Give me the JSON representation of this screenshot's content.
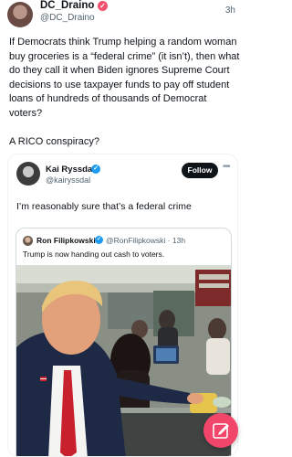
{
  "post": {
    "display_name": "DC_Draino",
    "handle": "@DC_Draino",
    "time": "3h",
    "text": "If Democrats think Trump helping a random woman buy groceries is a “federal crime” (it isn’t), then what do they call it when Biden ignores Supreme Court decisions to use taxpayer funds to pay off student loans of hundreds of thousands of Democrat voters?\n\nA RICO conspiracy?"
  },
  "quoted": {
    "display_name": "Kai Ryssdal",
    "handle": "@kairyssdal",
    "follow_label": "Follow",
    "text": "I’m reasonably sure that’s a federal crime"
  },
  "inner_quote": {
    "display_name": "Ron Filipkowski",
    "handle_time": "@RonFilipkowski · 13h",
    "text": "Trump is now handing out cash to voters."
  },
  "colors": {
    "badge_red": "#f0506e",
    "badge_blue": "#1d9bf0",
    "compose_fab": "#f1466a"
  },
  "icons": {
    "verified_red": "verified-badge-icon",
    "verified_blue": "verified-badge-icon",
    "more": "more-horizontal-icon",
    "compose": "compose-pen-icon"
  }
}
